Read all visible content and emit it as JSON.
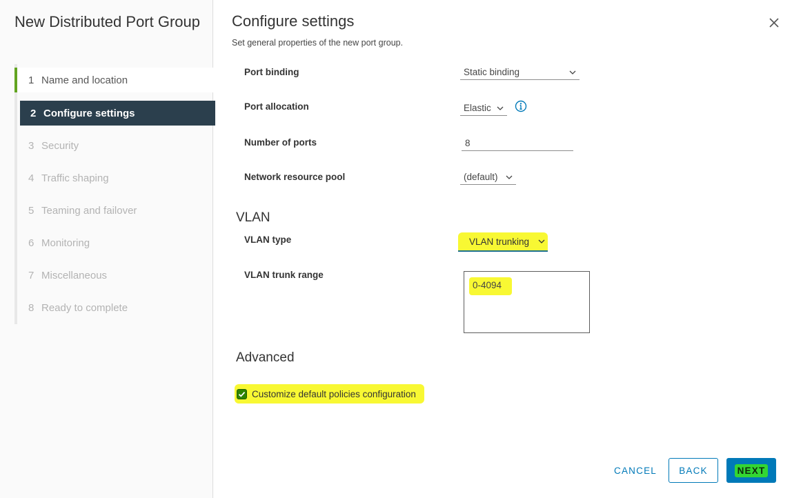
{
  "wizard": {
    "title": "New Distributed Port Group",
    "steps": [
      {
        "number": "1",
        "label": "Name and location",
        "state": "completed"
      },
      {
        "number": "2",
        "label": "Configure settings",
        "state": "active"
      },
      {
        "number": "3",
        "label": "Security",
        "state": "disabled"
      },
      {
        "number": "4",
        "label": "Traffic shaping",
        "state": "disabled"
      },
      {
        "number": "5",
        "label": "Teaming and failover",
        "state": "disabled"
      },
      {
        "number": "6",
        "label": "Monitoring",
        "state": "disabled"
      },
      {
        "number": "7",
        "label": "Miscellaneous",
        "state": "disabled"
      },
      {
        "number": "8",
        "label": "Ready to complete",
        "state": "disabled"
      }
    ]
  },
  "page": {
    "title": "Configure settings",
    "subtitle": "Set general properties of the new port group."
  },
  "settings": {
    "port_binding": {
      "label": "Port binding",
      "value": "Static binding"
    },
    "port_allocation": {
      "label": "Port allocation",
      "value": "Elastic"
    },
    "number_of_ports": {
      "label": "Number of ports",
      "value": "8"
    },
    "network_resource_pool": {
      "label": "Network resource pool",
      "value": "(default)"
    }
  },
  "vlan": {
    "section_title": "VLAN",
    "type": {
      "label": "VLAN type",
      "value": "VLAN trunking"
    },
    "trunk_range": {
      "label": "VLAN trunk range",
      "value": "0-4094"
    }
  },
  "advanced": {
    "section_title": "Advanced",
    "customize_label": "Customize default policies configuration",
    "customize_checked": true
  },
  "footer": {
    "cancel_label": "CANCEL",
    "back_label": "BACK",
    "next_label": "NEXT"
  },
  "colors": {
    "accent": "#0079b8",
    "active_step_bg": "#2b3f4d",
    "completed_step_marker": "#62a420",
    "highlight": "#ffff33",
    "checkbox": "#2f8400"
  },
  "icons": {
    "close": "close-icon",
    "info": "info-icon",
    "chevron": "chevron-down-icon",
    "check": "check-icon"
  }
}
